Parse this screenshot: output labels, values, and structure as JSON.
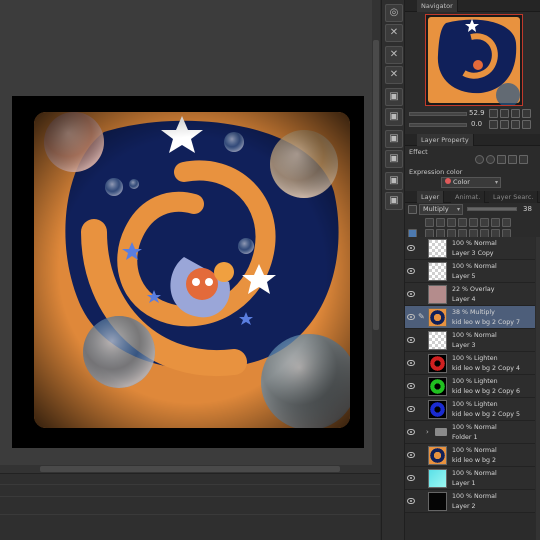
{
  "navigator": {
    "tab_label": "Navigator",
    "zoom": "52.9",
    "angle": "0.0"
  },
  "layer_property": {
    "tab_label": "Layer Property",
    "effect_label": "Effect",
    "expression_color_label": "Expression color",
    "expression_color_value": "Color"
  },
  "layer_panel": {
    "tabs": [
      "Layer",
      "Animat.",
      "Layer Searc."
    ],
    "blend_mode": "Multiply",
    "opacity": "38",
    "layers": [
      {
        "mode": "100 % Normal",
        "name": "Layer 3 Copy",
        "thumb": "checker"
      },
      {
        "mode": "100 % Normal",
        "name": "Layer 5",
        "thumb": "checker"
      },
      {
        "mode": "22 % Overlay",
        "name": "Layer 4",
        "thumb": "mauve"
      },
      {
        "mode": "38 % Multiply",
        "name": "kid leo w bg 2  Copy 7",
        "thumb": "art",
        "selected": true
      },
      {
        "mode": "100 % Normal",
        "name": "Layer 3",
        "thumb": "checker"
      },
      {
        "mode": "100 % Lighten",
        "name": "kid leo w bg 2  Copy 4",
        "thumb": "red"
      },
      {
        "mode": "100 % Lighten",
        "name": "kid leo w bg 2  Copy 6",
        "thumb": "green"
      },
      {
        "mode": "100 % Lighten",
        "name": "kid leo w bg 2  Copy 5",
        "thumb": "blue"
      },
      {
        "mode": "100 % Normal",
        "name": "Folder 1",
        "thumb": "folder"
      },
      {
        "mode": "100 % Normal",
        "name": "kid leo w bg 2",
        "thumb": "art"
      },
      {
        "mode": "100 % Normal",
        "name": "Layer 1",
        "thumb": "cyan"
      },
      {
        "mode": "100 % Normal",
        "name": "Layer 2",
        "thumb": "black"
      }
    ]
  },
  "colors": {
    "orange": "#e8923f",
    "navy": "#10205a",
    "selection": "#4d5e7a",
    "accent_red": "#c0392b"
  }
}
